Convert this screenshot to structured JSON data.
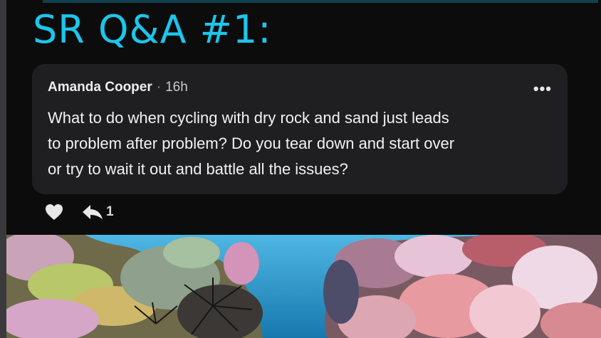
{
  "title": "SR Q&A #1:",
  "post": {
    "author": "Amanda Cooper",
    "separator": "·",
    "time": "16h",
    "more_label": "•••",
    "lines": [
      "What to do when cycling with dry rock and sand just leads",
      "to problem after problem? Do you tear down and start over",
      "or try to wait it out and battle all the issues?"
    ]
  },
  "actions": {
    "reply_count": "1"
  },
  "colors": {
    "title": "#1cc6ec",
    "card": "#1f1f21",
    "background": "#0c0c0d",
    "water": "#1f8fc2"
  },
  "icons": {
    "like": "heart-icon",
    "reply": "reply-arrow-icon",
    "more": "more-dots-icon"
  }
}
